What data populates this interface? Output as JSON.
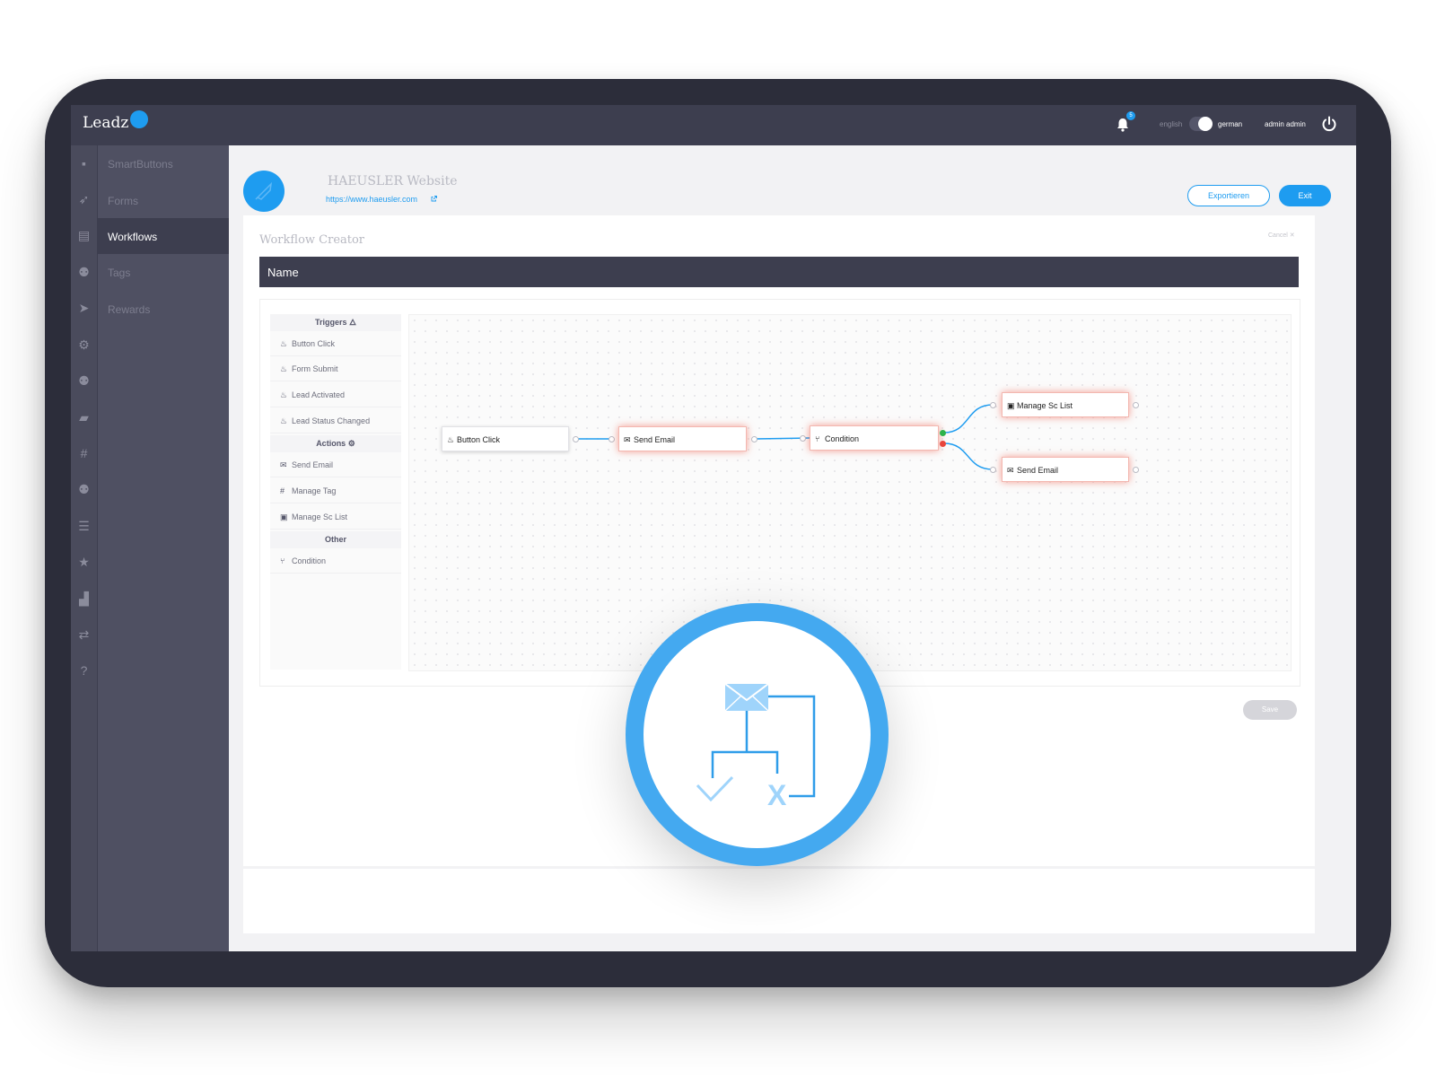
{
  "app": {
    "logo_text": "Leadz",
    "brand_color": "#1e9cf0"
  },
  "topbar": {
    "notification_count": "5",
    "lang_inactive": "english",
    "lang_active": "german",
    "user_name": "admin admin"
  },
  "sidebar": {
    "icons": [
      "dashboard-icon",
      "rocket-icon",
      "forms-icon",
      "people-icon",
      "send-icon",
      "gear-icon",
      "people-icon",
      "map-icon",
      "hash-icon",
      "people-icon",
      "list-icon",
      "star-icon",
      "signal-icon",
      "translate-icon",
      "help-icon"
    ],
    "items": [
      {
        "label": "SmartButtons"
      },
      {
        "label": "Forms"
      },
      {
        "label": "Workflows",
        "active": true
      },
      {
        "label": "Tags"
      },
      {
        "label": "Rewards"
      }
    ]
  },
  "project": {
    "title": "HAEUSLER Website",
    "url": "https://www.haeusler.com",
    "export_label": "Exportieren",
    "exit_label": "Exit"
  },
  "workflow": {
    "title": "Workflow Creator",
    "cancel_label": "Cancel ✕",
    "name_placeholder": "Name",
    "save_label": "Save"
  },
  "palette": {
    "triggers_title": "Triggers",
    "triggers": [
      "Button Click",
      "Form Submit",
      "Lead Activated",
      "Lead Status Changed"
    ],
    "actions_title": "Actions",
    "actions": [
      {
        "label": "Send Email",
        "icon": "envelope-icon"
      },
      {
        "label": "Manage Tag",
        "icon": "hash-icon"
      },
      {
        "label": "Manage Sc List",
        "icon": "contact-card-icon"
      }
    ],
    "other_title": "Other",
    "other": [
      {
        "label": "Condition",
        "icon": "branch-icon"
      }
    ]
  },
  "canvas": {
    "nodes": [
      {
        "label": "Button Click",
        "icon": "flame-icon"
      },
      {
        "label": "Send Email",
        "icon": "envelope-icon"
      },
      {
        "label": "Condition",
        "icon": "branch-icon"
      },
      {
        "label": "Manage Sc List",
        "icon": "contact-card-icon"
      },
      {
        "label": "Send Email",
        "icon": "envelope-icon"
      }
    ],
    "wire_color": "#1e9cf0",
    "true_port_color": "#2db34a",
    "false_port_color": "#e8453c"
  },
  "overlay": {
    "icon": "email-workflow-icon",
    "ring_color": "#44a9f0",
    "fail_mark": "X"
  }
}
